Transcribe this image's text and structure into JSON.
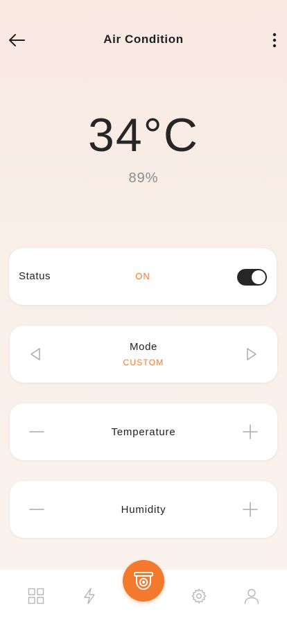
{
  "header": {
    "title": "Air Condition",
    "back_icon": "arrow-left-icon",
    "more_icon": "more-vertical-icon"
  },
  "readout": {
    "temperature": "34°C",
    "humidity": "89%"
  },
  "status": {
    "label": "Status",
    "value": "ON",
    "toggle_on": true
  },
  "mode": {
    "title": "Mode",
    "value": "CUSTOM",
    "prev_icon": "triangle-left-icon",
    "next_icon": "triangle-right-icon"
  },
  "temperature_control": {
    "label": "Temperature",
    "minus_icon": "minus-icon",
    "plus_icon": "plus-icon"
  },
  "humidity_control": {
    "label": "Humidity",
    "minus_icon": "minus-icon",
    "plus_icon": "plus-icon"
  },
  "tabbar": {
    "items": [
      "grid-icon",
      "lightning-icon",
      "camera-icon",
      "gear-icon",
      "user-icon"
    ],
    "active": "camera-icon"
  },
  "colors": {
    "accent": "#f2792d",
    "toggle_track": "#262626",
    "background_top": "#f8e9e1",
    "background_bottom": "#fbf3ee"
  }
}
